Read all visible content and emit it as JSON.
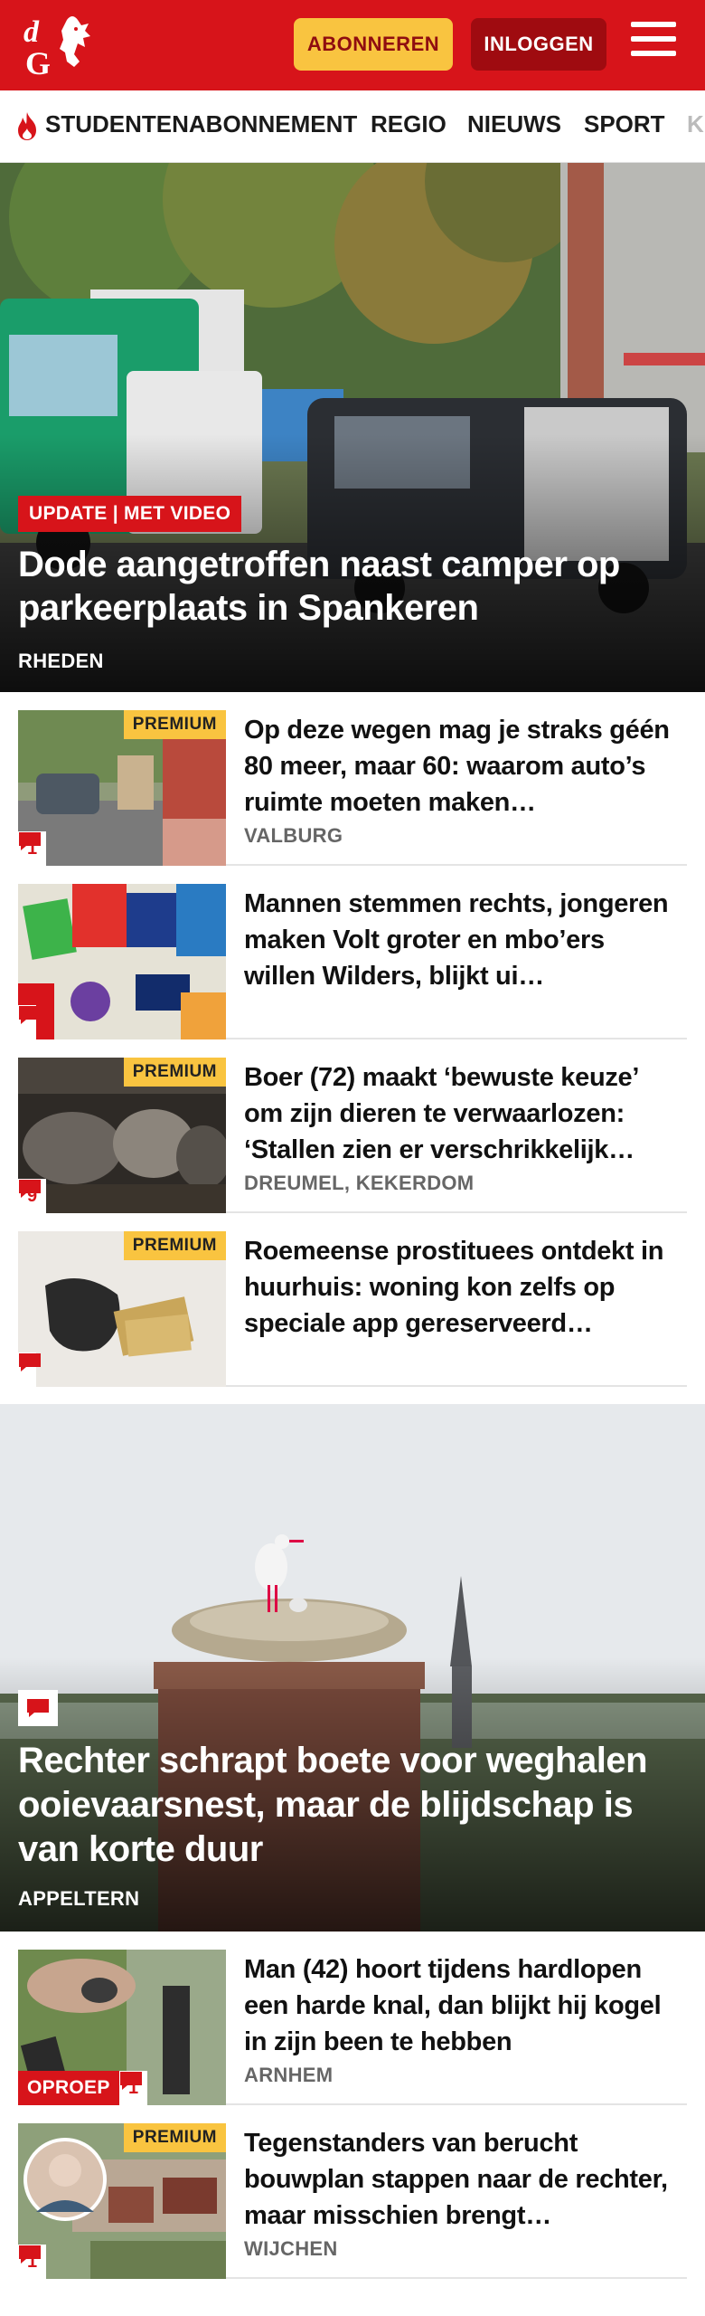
{
  "header": {
    "logo_text": "dG",
    "subscribe_label": "ABONNEREN",
    "login_label": "INLOGGEN",
    "brand_color": "#d7141a",
    "accent_color": "#f9c440"
  },
  "nav": {
    "items": [
      "STUDENTENABONNEMENT",
      "REGIO",
      "NIEUWS",
      "SPORT",
      "K"
    ],
    "trending_icon": "flame-icon"
  },
  "hero": {
    "tag": "UPDATE | MET VIDEO",
    "title": "Dode aangetroffen naast camper op parkeerplaats in Spankeren",
    "location": "RHEDEN"
  },
  "articles": [
    {
      "title": "Op deze wegen mag je straks géén 80 meer, maar 60: waarom auto’s ruimte moeten maken…",
      "location": "VALBURG",
      "premium": "PREMIUM",
      "comments": "1"
    },
    {
      "title": "Mannen stemmen rechts, jongeren maken Volt groter en mbo’ers willen Wilders, blijkt ui…",
      "location": "",
      "premium": "",
      "comments": ""
    },
    {
      "title": "Boer (72) maakt ‘bewuste keuze’ om zijn dieren te verwaarlozen: ‘Stallen zien er verschrikkelijk…",
      "location": "DREUMEL, KEKERDOM",
      "premium": "PREMIUM",
      "comments": "9"
    },
    {
      "title": "Roemeense prostituees ontdekt in huurhuis: woning kon zelfs op speciale app gereserveerd…",
      "location": "",
      "premium": "PREMIUM",
      "comments": ""
    }
  ],
  "hero2": {
    "title": "Rechter schrapt boete voor weghalen ooievaarsnest, maar de blijdschap is van korte duur",
    "location": "APPELTERN"
  },
  "articles2": [
    {
      "title": "Man (42) hoort tijdens hardlopen een harde knal, dan blijkt hij kogel in zijn been te hebben",
      "location": "ARNHEM",
      "oproep": "OPROEP",
      "comments": "1"
    },
    {
      "title": "Tegenstanders van berucht bouwplan stappen naar de rechter, maar misschien brengt…",
      "location": "WIJCHEN",
      "premium": "PREMIUM",
      "comments": "1"
    }
  ]
}
